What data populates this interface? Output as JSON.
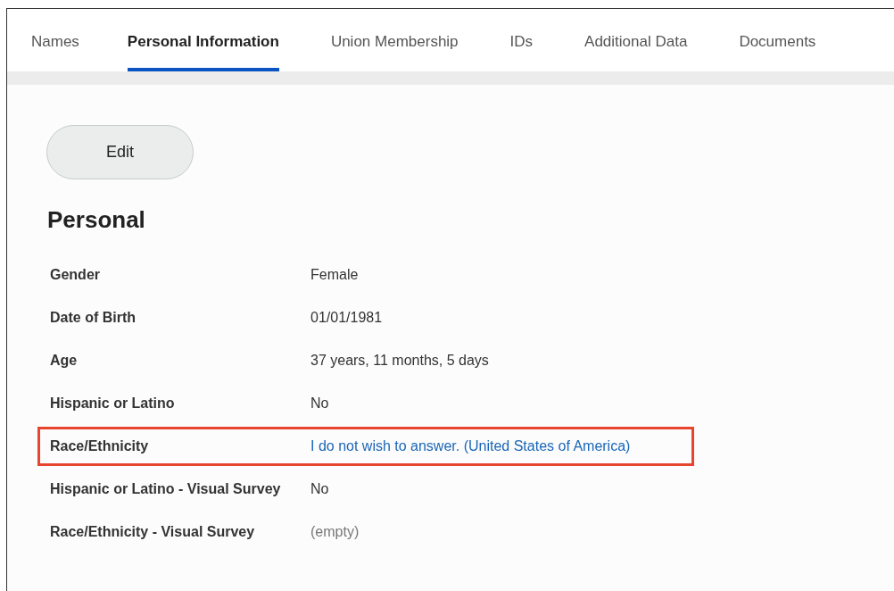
{
  "tabs": [
    {
      "label": "Names",
      "selected": false
    },
    {
      "label": "Personal Information",
      "selected": true
    },
    {
      "label": "Union Membership",
      "selected": false
    },
    {
      "label": "IDs",
      "selected": false
    },
    {
      "label": "Additional Data",
      "selected": false
    },
    {
      "label": "Documents",
      "selected": false
    }
  ],
  "edit_button": "Edit",
  "section_title": "Personal",
  "fields": [
    {
      "label": "Gender",
      "value": "Female",
      "kind": "text",
      "highlighted": false
    },
    {
      "label": "Date of Birth",
      "value": "01/01/1981",
      "kind": "text",
      "highlighted": false
    },
    {
      "label": "Age",
      "value": "37 years, 11 months, 5 days",
      "kind": "text",
      "highlighted": false
    },
    {
      "label": "Hispanic or Latino",
      "value": "No",
      "kind": "text",
      "highlighted": false
    },
    {
      "label": "Race/Ethnicity",
      "value": "I do not wish to answer. (United States of America)",
      "kind": "link",
      "highlighted": true
    },
    {
      "label": "Hispanic or Latino - Visual Survey",
      "value": "No",
      "kind": "text",
      "highlighted": false
    },
    {
      "label": "Race/Ethnicity - Visual Survey",
      "value": "(empty)",
      "kind": "empty",
      "highlighted": false
    }
  ]
}
